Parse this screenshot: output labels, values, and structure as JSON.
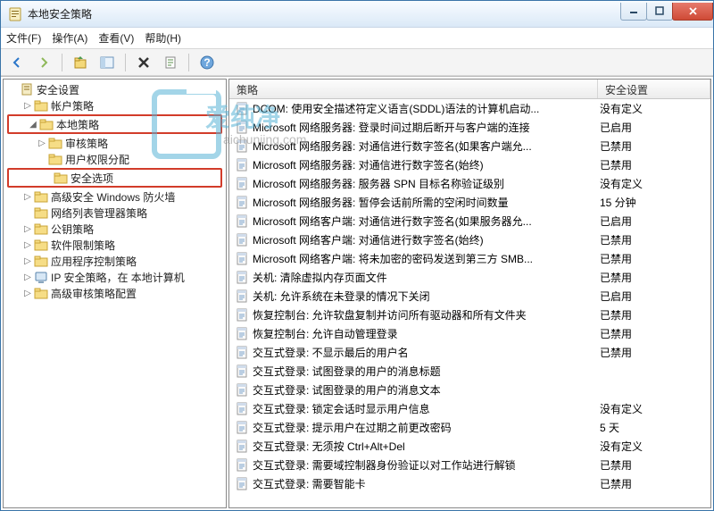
{
  "window": {
    "title": "本地安全策略"
  },
  "menu": {
    "file": "文件(F)",
    "action": "操作(A)",
    "view": "查看(V)",
    "help": "帮助(H)"
  },
  "tree": {
    "root": "安全设置",
    "items": [
      {
        "level": 1,
        "exp": "▷",
        "label": "帐户策略"
      },
      {
        "level": 1,
        "exp": "◢",
        "label": "本地策略",
        "highlight": true
      },
      {
        "level": 2,
        "exp": "▷",
        "label": "审核策略"
      },
      {
        "level": 2,
        "exp": "",
        "label": "用户权限分配"
      },
      {
        "level": 2,
        "exp": "",
        "label": "安全选项",
        "highlight": true
      },
      {
        "level": 1,
        "exp": "▷",
        "label": "高级安全 Windows 防火墙"
      },
      {
        "level": 1,
        "exp": "",
        "label": "网络列表管理器策略"
      },
      {
        "level": 1,
        "exp": "▷",
        "label": "公钥策略"
      },
      {
        "level": 1,
        "exp": "▷",
        "label": "软件限制策略"
      },
      {
        "level": 1,
        "exp": "▷",
        "label": "应用程序控制策略"
      },
      {
        "level": 1,
        "exp": "▷",
        "label": "IP 安全策略，在 本地计算机",
        "special": "ip"
      },
      {
        "level": 1,
        "exp": "▷",
        "label": "高级审核策略配置"
      }
    ]
  },
  "list": {
    "col_name": "策略",
    "col_setting": "安全设置",
    "rows": [
      {
        "name": "DCOM: 使用安全描述符定义语言(SDDL)语法的计算机启动...",
        "setting": "没有定义"
      },
      {
        "name": "Microsoft 网络服务器: 登录时间过期后断开与客户端的连接",
        "setting": "已启用"
      },
      {
        "name": "Microsoft 网络服务器: 对通信进行数字签名(如果客户端允...",
        "setting": "已禁用"
      },
      {
        "name": "Microsoft 网络服务器: 对通信进行数字签名(始终)",
        "setting": "已禁用"
      },
      {
        "name": "Microsoft 网络服务器: 服务器 SPN 目标名称验证级别",
        "setting": "没有定义"
      },
      {
        "name": "Microsoft 网络服务器: 暂停会话前所需的空闲时间数量",
        "setting": "15 分钟"
      },
      {
        "name": "Microsoft 网络客户端: 对通信进行数字签名(如果服务器允...",
        "setting": "已启用"
      },
      {
        "name": "Microsoft 网络客户端: 对通信进行数字签名(始终)",
        "setting": "已禁用"
      },
      {
        "name": "Microsoft 网络客户端: 将未加密的密码发送到第三方 SMB...",
        "setting": "已禁用"
      },
      {
        "name": "关机: 清除虚拟内存页面文件",
        "setting": "已禁用"
      },
      {
        "name": "关机: 允许系统在未登录的情况下关闭",
        "setting": "已启用"
      },
      {
        "name": "恢复控制台: 允许软盘复制并访问所有驱动器和所有文件夹",
        "setting": "已禁用"
      },
      {
        "name": "恢复控制台: 允许自动管理登录",
        "setting": "已禁用"
      },
      {
        "name": "交互式登录: 不显示最后的用户名",
        "setting": "已禁用"
      },
      {
        "name": "交互式登录: 试图登录的用户的消息标题",
        "setting": ""
      },
      {
        "name": "交互式登录: 试图登录的用户的消息文本",
        "setting": ""
      },
      {
        "name": "交互式登录: 锁定会话时显示用户信息",
        "setting": "没有定义"
      },
      {
        "name": "交互式登录: 提示用户在过期之前更改密码",
        "setting": "5 天"
      },
      {
        "name": "交互式登录: 无须按 Ctrl+Alt+Del",
        "setting": "没有定义"
      },
      {
        "name": "交互式登录: 需要域控制器身份验证以对工作站进行解锁",
        "setting": "已禁用"
      },
      {
        "name": "交互式登录: 需要智能卡",
        "setting": "已禁用"
      }
    ]
  },
  "watermark": {
    "big": "爱纯净",
    "small": "aichunjing.com"
  }
}
